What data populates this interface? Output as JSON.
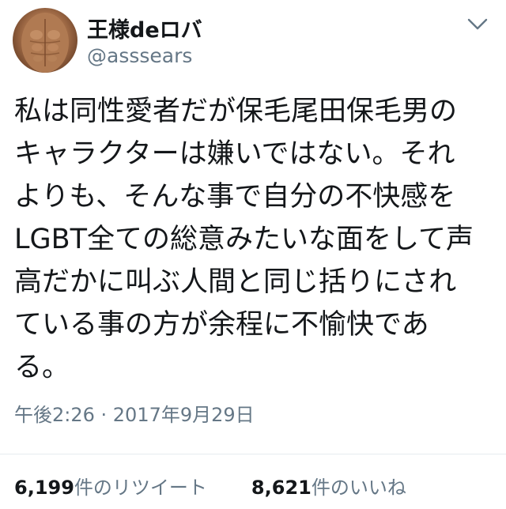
{
  "user": {
    "display_name": "王様deロバ",
    "handle": "@asssears"
  },
  "icons": {
    "avatar": "avatar-photo",
    "menu": "chevron-down-icon"
  },
  "tweet": {
    "lines": [
      "私は同性愛者だが保毛尾田保毛男の",
      "キャラクターは嫌いではない。それ",
      "よりも、そんな事で自分の不快感を",
      "LGBT全ての総意みたいな面をして声",
      "高だかに叫ぶ人間と同じ括りにされ",
      "ている事の方が余程に不愉快であ",
      "る。"
    ],
    "timestamp": "午後2:26 · 2017年9月29日"
  },
  "stats": {
    "retweets_count": "6,199",
    "retweets_label": "件のリツイート",
    "likes_count": "8,621",
    "likes_label": "件のいいね"
  },
  "colors": {
    "text_primary": "#14171a",
    "text_secondary": "#657786",
    "divider": "#e6ecf0"
  }
}
